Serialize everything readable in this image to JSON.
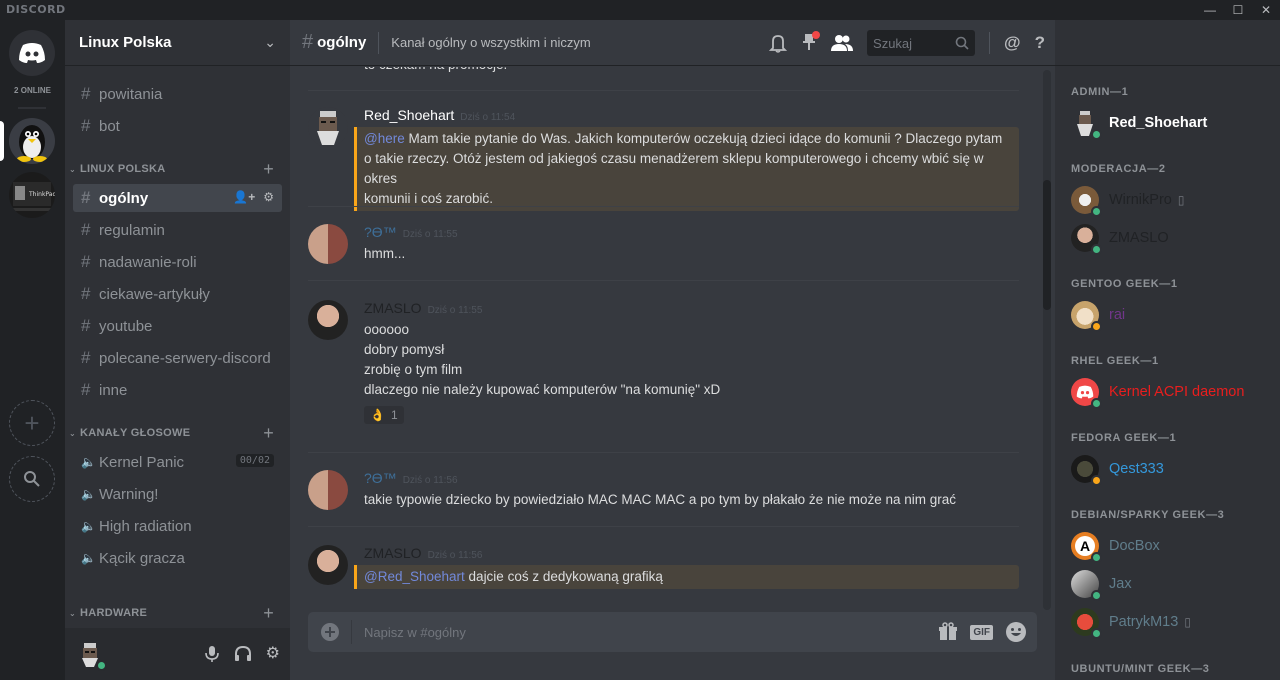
{
  "app": {
    "brand": "DISCORD",
    "window_controls": [
      "minimize",
      "maximize",
      "close"
    ]
  },
  "guilds": {
    "online_count": "2 ONLINE",
    "items": [
      {
        "name": "Linux Polska",
        "icon": "tux-penguin-icon",
        "selected": true
      },
      {
        "name": "ThinkPad",
        "icon": "thinkpad-server-icon",
        "selected": false
      }
    ],
    "add_server_icon": "plus-icon",
    "discover_icon": "search-icon"
  },
  "server": {
    "name": "Linux Polska",
    "top_channels": [
      {
        "name": "powitania"
      },
      {
        "name": "bot"
      }
    ],
    "categories": [
      {
        "name": "LINUX POLSKA",
        "channels": [
          {
            "name": "ogólny",
            "active": true
          },
          {
            "name": "regulamin"
          },
          {
            "name": "nadawanie-roli"
          },
          {
            "name": "ciekawe-artykuły"
          },
          {
            "name": "youtube"
          },
          {
            "name": "polecane-serwery-discord"
          },
          {
            "name": "inne"
          }
        ]
      },
      {
        "name": "KANAŁY GŁOSOWE",
        "voice_channels": [
          {
            "name": "Kernel Panic",
            "user_limit": "00/02"
          },
          {
            "name": "Warning!"
          },
          {
            "name": "High radiation"
          },
          {
            "name": "Kącik gracza"
          }
        ]
      },
      {
        "name": "HARDWARE",
        "channels": []
      }
    ]
  },
  "user_panel": {
    "status_color": "#43b581",
    "controls": [
      "microphone-icon",
      "headphones-icon",
      "settings-gear-icon"
    ]
  },
  "chat": {
    "channel_name": "ogólny",
    "topic": "Kanał ogólny o wszystkim i niczym",
    "search_placeholder": "Szukaj",
    "partial_top_line": "to czekam na promocje.",
    "messages": [
      {
        "author": "Red_Shoehart",
        "author_color": "#ffffff",
        "time": "Dziś o 11:54",
        "mention_highlight": true,
        "mention": "@here",
        "lines": [
          "Mam takie pytanie do Was. Jakich komputerów oczekują dzieci idące do komunii ? Dlaczego pytam",
          "o takie rzeczy. Otóż jestem od jakiegoś czasu menadżerem sklepu komputerowego i chcemy wbić się w okres",
          "komunii i coś zarobić."
        ]
      },
      {
        "author": "?ϴ™",
        "author_color": "#3e6f99",
        "time": "Dziś o 11:55",
        "lines": [
          "hmm..."
        ]
      },
      {
        "author": "ZMASLO",
        "author_color": "#202225",
        "time": "Dziś o 11:55",
        "lines": [
          "oooooo",
          "dobry pomysł",
          "zrobię o tym film",
          "dlaczego nie należy kupować komputerów \"na komunię\" xD"
        ],
        "reaction": {
          "emoji": "👌",
          "count": "1"
        }
      },
      {
        "author": "?ϴ™",
        "author_color": "#3e6f99",
        "time": "Dziś o 11:56",
        "lines": [
          "takie typowie dziecko by powiedziało MAC MAC MAC a po tym by płakało że nie może na nim grać"
        ]
      },
      {
        "author": "ZMASLO",
        "author_color": "#202225",
        "time": "Dziś o 11:56",
        "mention_highlight": true,
        "mention": "@Red_Shoehart",
        "lines": [
          "dajcie coś z dedykowaną grafiką"
        ]
      }
    ],
    "composer_placeholder": "Napisz w #ogólny"
  },
  "members": {
    "groups": [
      {
        "label": "ADMIN—1",
        "members": [
          {
            "name": "Red_Shoehart",
            "color": "#ffffff",
            "status": "online",
            "bold": true
          }
        ]
      },
      {
        "label": "MODERACJA—2",
        "members": [
          {
            "name": "WirnikPro",
            "color": "#202225",
            "status": "online",
            "mobile": true
          },
          {
            "name": "ZMASLO",
            "color": "#202225",
            "status": "online"
          }
        ]
      },
      {
        "label": "GENTOO GEEK—1",
        "members": [
          {
            "name": "rai",
            "color": "#71368a",
            "status": "idle"
          }
        ]
      },
      {
        "label": "RHEL GEEK—1",
        "members": [
          {
            "name": "Kernel ACPI daemon",
            "color": "#e91e1e",
            "status": "online"
          }
        ]
      },
      {
        "label": "FEDORA GEEK—1",
        "members": [
          {
            "name": "Qest333",
            "color": "#3498db",
            "status": "idle"
          }
        ]
      },
      {
        "label": "DEBIAN/SPARKY GEEK—3",
        "members": [
          {
            "name": "DocBox",
            "color": "#607d8b",
            "status": "online"
          },
          {
            "name": "Jax",
            "color": "#607d8b",
            "status": "online"
          },
          {
            "name": "PatrykM13",
            "color": "#607d8b",
            "status": "online",
            "mobile": true
          }
        ]
      },
      {
        "label": "UBUNTU/MINT GEEK—3",
        "members": []
      }
    ]
  },
  "colors": {
    "accent": "#7289da",
    "online": "#43b581",
    "idle": "#faa61a",
    "mention_bar": "#faa61a"
  }
}
